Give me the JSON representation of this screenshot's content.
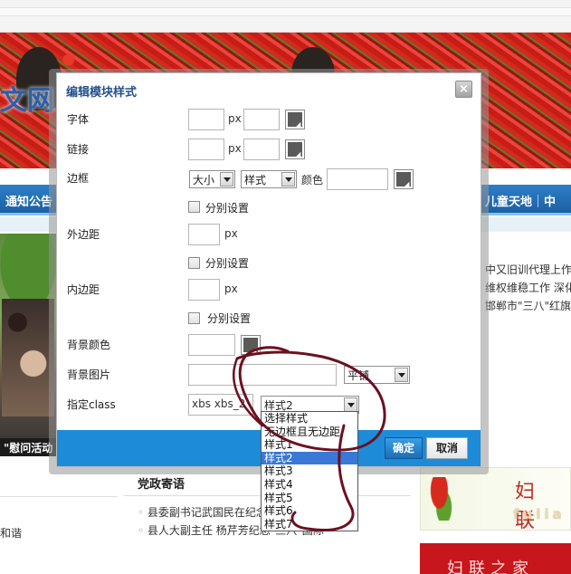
{
  "background": {
    "logo_text": "文网",
    "nav_left": "通知公告",
    "nav_right": [
      "儿童天地",
      "中"
    ],
    "photo_caption": "\"慰问活动",
    "right_news": [
      "中又旧训代理上作",
      "维权维稳工作 深化",
      "邯郸市\"三八\"红旗手"
    ],
    "section_title": "党政寄语",
    "news_items": [
      "县委副书记武国民在纪念",
      "县人大副主任 杨芹芳纪念\"三八\"国际"
    ],
    "left_snippet": "和谐",
    "ad1_title": "妇 联",
    "ad1_sub": "fulia",
    "ad2_text": "妇联之家"
  },
  "dialog": {
    "title": "编辑模块样式",
    "close_label": "×",
    "font_label": "字体",
    "link_label": "链接",
    "border_label": "边框",
    "margin_label": "外边距",
    "padding_label": "内边距",
    "bgcolor_label": "背景颜色",
    "bgimage_label": "背景图片",
    "class_label": "指定class",
    "px_unit": "px",
    "color_label": "颜色",
    "border_size_select": "大小",
    "border_style_select": "样式",
    "split_setting_label": "分别设置",
    "bg_repeat_select": "平铺",
    "class_value": "xbs xbs_2",
    "class_select_value": "样式2",
    "dropdown_options": [
      "选择样式",
      "无边框且无边距",
      "样式1",
      "样式2",
      "样式3",
      "样式4",
      "样式5",
      "样式6",
      "样式7"
    ],
    "dropdown_selected_index": 3,
    "ok_label": "确定",
    "cancel_label": "取消"
  },
  "colors": {
    "nav_blue": "#1d5fa3",
    "footer_blue": "#1e8bd8",
    "title_blue": "#24508a",
    "swatch_gray": "#5a5a5a",
    "scribble": "#6b1020"
  }
}
